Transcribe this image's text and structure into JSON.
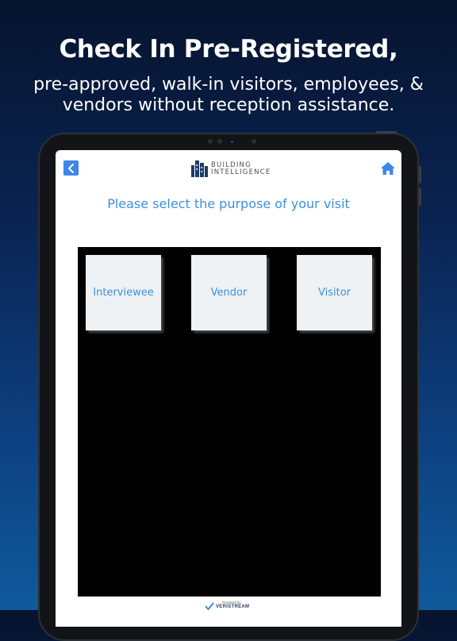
{
  "headline": "Check In Pre-Registered,",
  "subline": "pre-approved, walk-in visitors, employees, & vendors without reception assistance.",
  "app": {
    "logo_text_line1": "BUILDING",
    "logo_text_line2": "INTELLIGENCE",
    "prompt": "Please select the purpose of your visit",
    "options": [
      {
        "label": "Interviewee"
      },
      {
        "label": "Vendor"
      },
      {
        "label": "Visitor"
      }
    ],
    "footer_powered_by": "Powered by",
    "footer_brand": "VERISTREAM"
  },
  "icons": {
    "back": "chevron-left-icon",
    "home": "home-icon"
  },
  "colors": {
    "accent": "#3d8fe0",
    "tile_bg": "#eef2f4",
    "panel_bg": "#000000"
  }
}
